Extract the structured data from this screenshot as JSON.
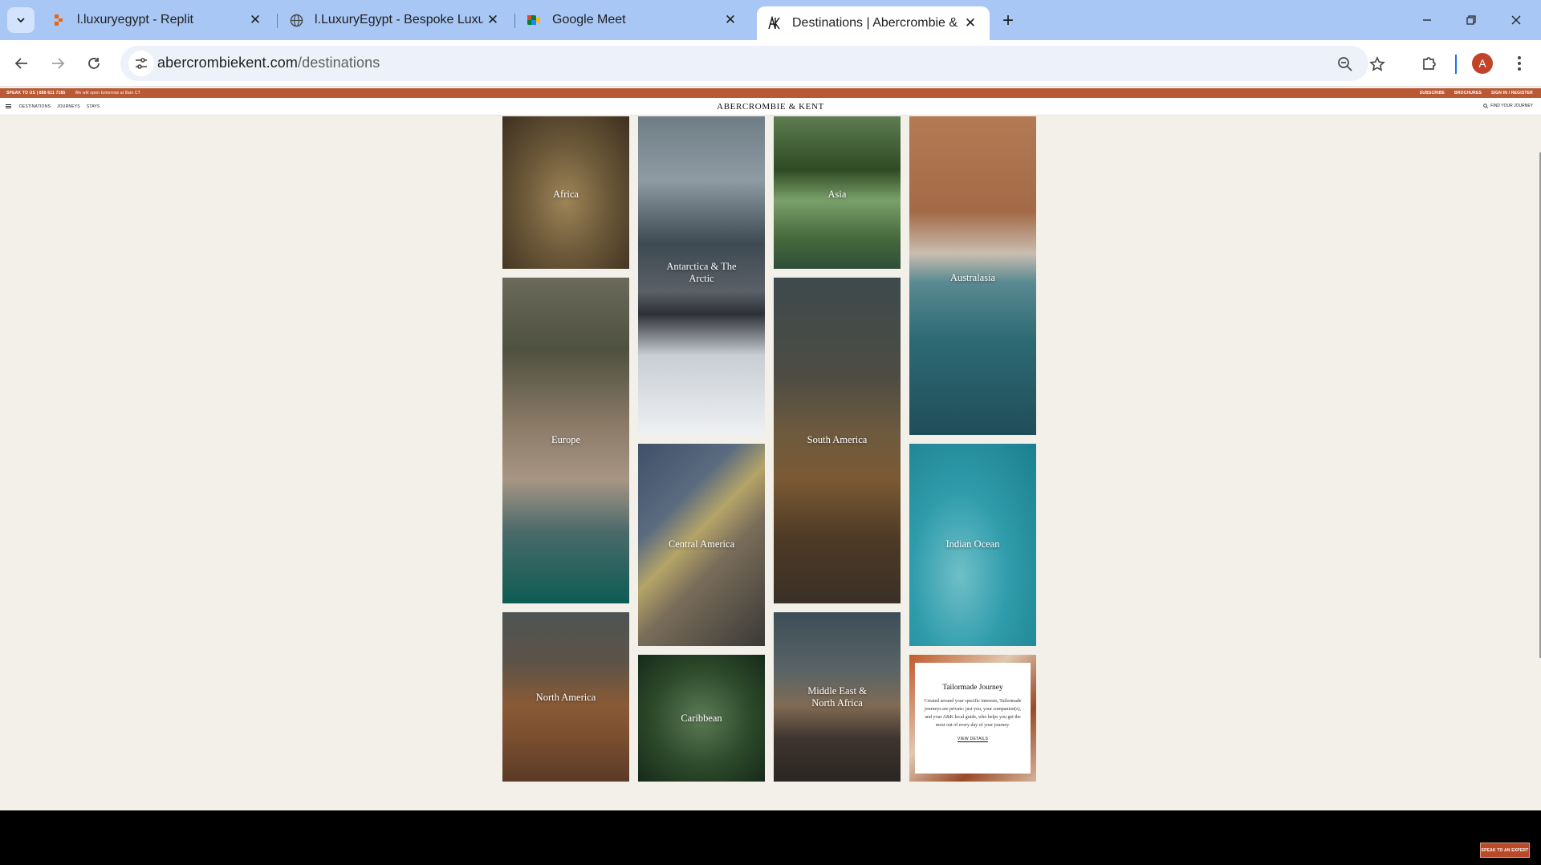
{
  "browser": {
    "tabs": [
      {
        "title": "l.luxuryegypt - Replit",
        "favicon": "replit-icon",
        "active": false
      },
      {
        "title": "l.LuxuryEgypt - Bespoke Luxury",
        "favicon": "globe-icon",
        "active": false
      },
      {
        "title": "Google Meet",
        "favicon": "google-meet-icon",
        "active": false
      },
      {
        "title": "Destinations | Abercrombie & K",
        "favicon": "ak-logo-icon",
        "active": true
      }
    ],
    "url_host": "abercrombiekent.com",
    "url_path": "/destinations",
    "profile_initial": "A",
    "accent_color": "#a8c7f5"
  },
  "site": {
    "announcement_left": "SPEAK TO US | 888 611 7185",
    "announcement_left_note": "We will open tomorrow at 8am CT",
    "announcement_right": [
      "SUBSCRIBE",
      "BROCHURES",
      "SIGN IN / REGISTER"
    ],
    "logo": "ABERCROMBIE & KENT",
    "nav": [
      "DESTINATIONS",
      "JOURNEYS",
      "STAYS"
    ],
    "find_journey": "FIND YOUR JOURNEY",
    "brand_color": "#b95a34"
  },
  "destinations": [
    {
      "name": "Africa"
    },
    {
      "name": "Antarctica & The Arctic"
    },
    {
      "name": "Asia"
    },
    {
      "name": "Australasia"
    },
    {
      "name": "Europe"
    },
    {
      "name": "South America"
    },
    {
      "name": "Central America"
    },
    {
      "name": "Indian Ocean"
    },
    {
      "name": "North America"
    },
    {
      "name": "Caribbean"
    },
    {
      "name": "Middle East & North Africa"
    }
  ],
  "promo": {
    "title": "Tailormade Journey",
    "body": "Created around your specific interests, Tailormade journeys are private: just you, your companion(s), and your A&K local guide, who helps you get the most out of every day of your journey.",
    "link": "VIEW DETAILS"
  },
  "speak_button": "SPEAK TO AN EXPERT"
}
